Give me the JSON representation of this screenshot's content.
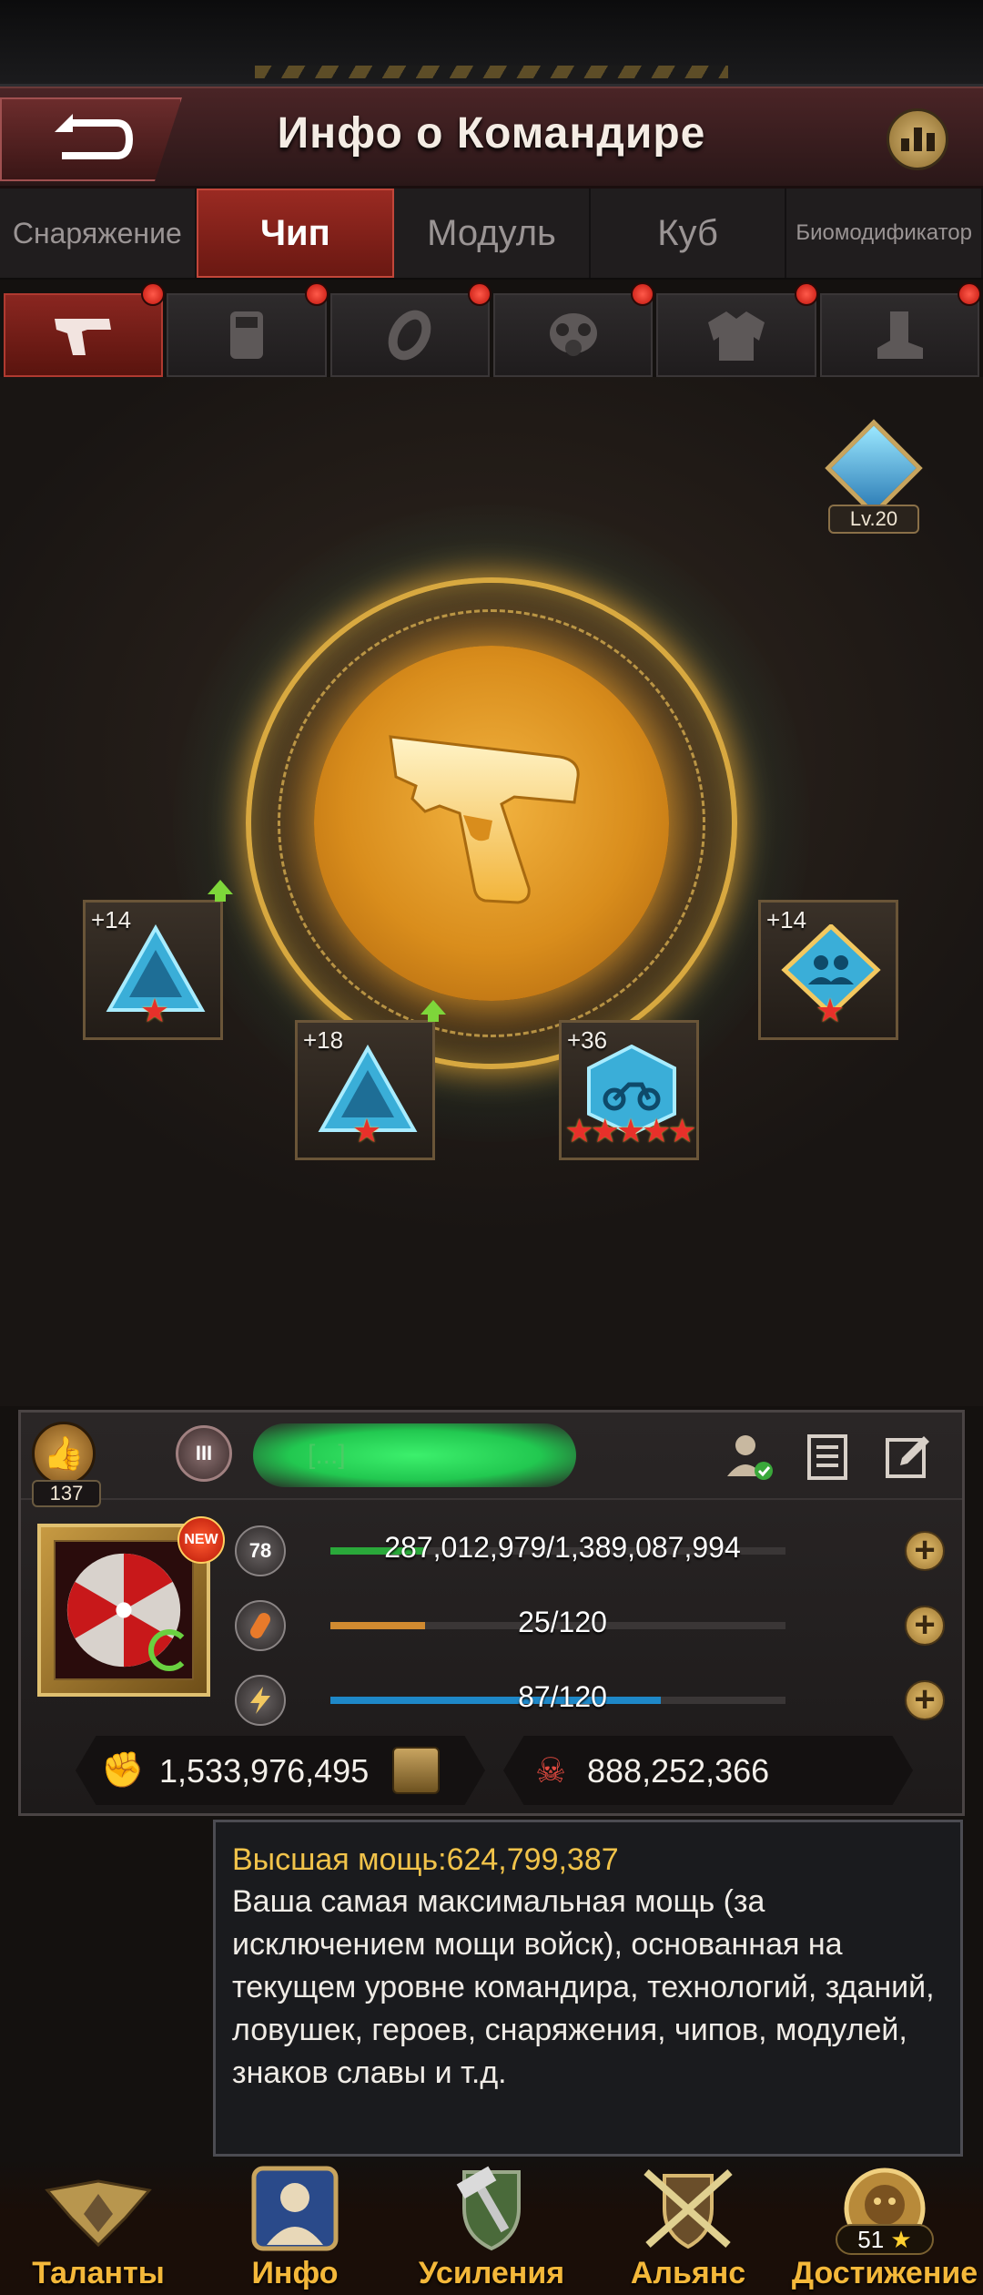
{
  "header": {
    "title": "Инфо о Командире"
  },
  "tabs": [
    {
      "label": "Снаряжение",
      "active": false
    },
    {
      "label": "Чип",
      "active": true
    },
    {
      "label": "Модуль",
      "active": false
    },
    {
      "label": "Куб",
      "active": false
    },
    {
      "label": "Биомодификатор",
      "active": false
    }
  ],
  "slots": [
    {
      "icon": "pistol-icon",
      "active": true,
      "notification": true
    },
    {
      "icon": "armor-plate-icon",
      "active": false,
      "notification": true
    },
    {
      "icon": "ring-icon",
      "active": false,
      "notification": true
    },
    {
      "icon": "gas-mask-icon",
      "active": false,
      "notification": true
    },
    {
      "icon": "jacket-icon",
      "active": false,
      "notification": true
    },
    {
      "icon": "boot-icon",
      "active": false,
      "notification": true
    }
  ],
  "equipment": {
    "level_badge": "Lv.20",
    "center_icon": "golden-pistol-icon"
  },
  "chips": [
    {
      "level": "+14",
      "shape": "triangle",
      "stars": 1,
      "upgrade": true
    },
    {
      "level": "+18",
      "shape": "triangle",
      "stars": 1,
      "upgrade": true
    },
    {
      "level": "+36",
      "shape": "hexagon-motorcycle",
      "stars": 5,
      "upgrade": false
    },
    {
      "level": "+14",
      "shape": "diamond-squad",
      "stars": 1,
      "upgrade": false
    }
  ],
  "commander": {
    "rank_number": "137",
    "alliance_rank": "III",
    "name": "[...]",
    "avatar_badge": "NEW",
    "level": "78",
    "exp": "287,012,979/1,389,087,994",
    "exp_fraction": 0.207,
    "stamina": "25/120",
    "stamina_fraction": 0.208,
    "energy": "87/120",
    "energy_fraction": 0.725,
    "power": "1,533,976,495",
    "kills": "888,252,366"
  },
  "tooltip": {
    "title": "Высшая мощь:624,799,387",
    "body": "Ваша самая максимальная мощь (за исключением мощи войск), основанная на текущем уровне командира, технологий, зданий, ловушек, героев, снаряжения, чипов, модулей, знаков славы и т.д."
  },
  "nav": [
    {
      "label": "Таланты",
      "icon": "wings-emblem-icon"
    },
    {
      "label": "Инфо",
      "icon": "commander-info-icon"
    },
    {
      "label": "Усиления",
      "icon": "hammer-shield-icon"
    },
    {
      "label": "Альянс",
      "icon": "crossed-swords-shield-icon"
    },
    {
      "label": "Достижение",
      "icon": "lion-medal-icon",
      "badge_count": "51",
      "badge_star": "★"
    }
  ],
  "colors": {
    "accent_red": "#9a2a22",
    "gold": "#f1c34a",
    "exp_bar": "#2aa83a",
    "stamina_bar": "#d08a30",
    "energy_bar": "#1e88c8"
  }
}
